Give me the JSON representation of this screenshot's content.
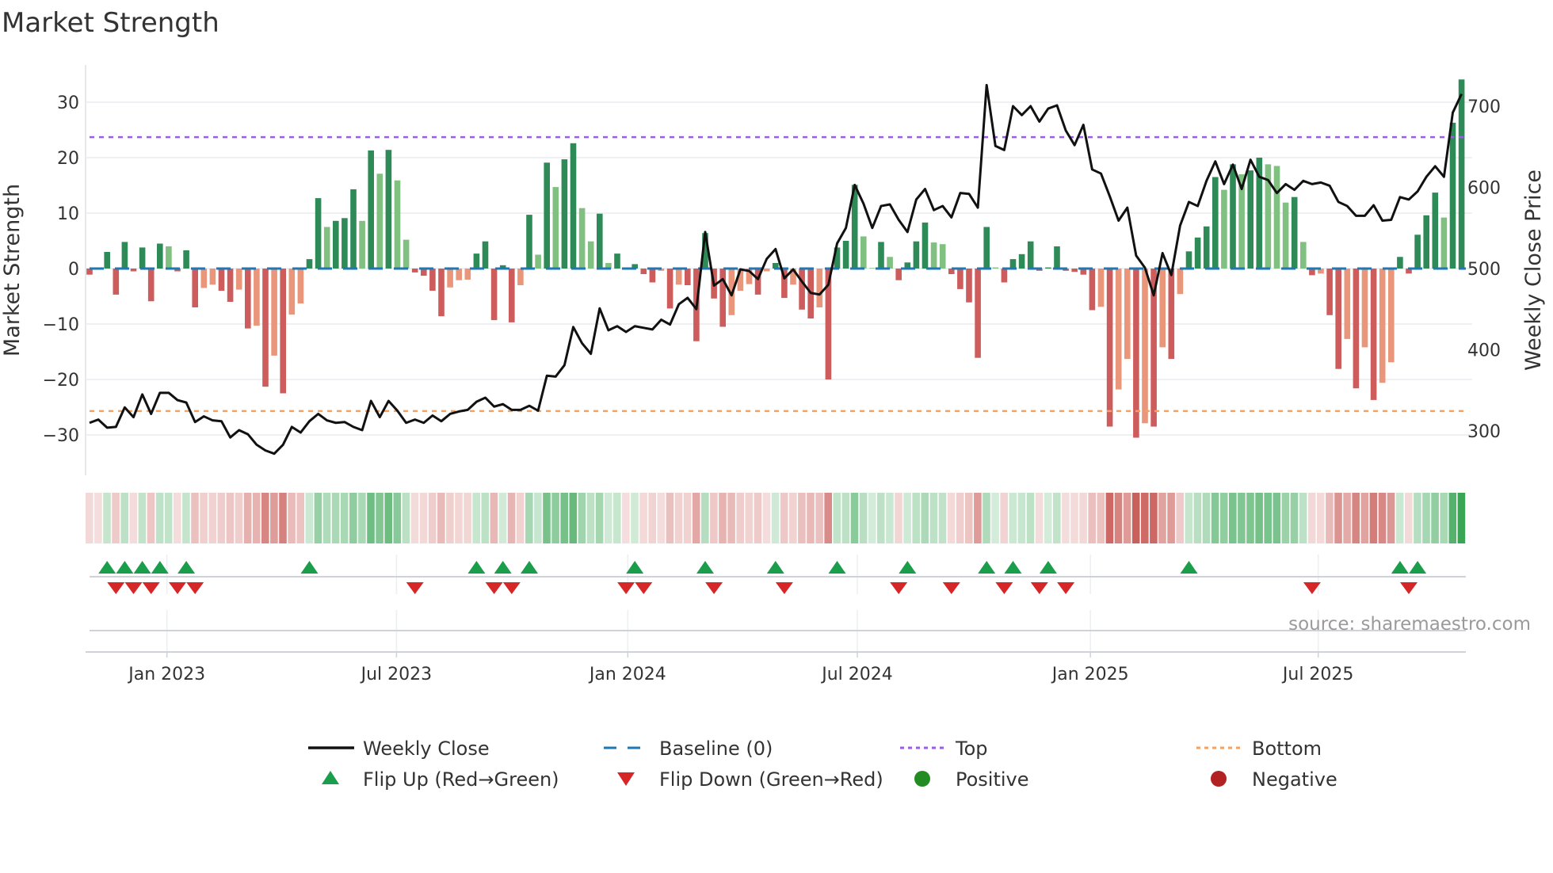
{
  "chart_data": {
    "type": "bar",
    "title": "Market Strength",
    "ylabel": "Market Strength",
    "y2label": "Weekly Close Price",
    "ylim": [
      -37.3,
      36.7
    ],
    "y2lim": [
      245,
      751
    ],
    "yticks": [
      -30,
      -20,
      -10,
      0,
      10,
      20,
      30
    ],
    "ytick_labels": [
      "−30",
      "−20",
      "−10",
      "0",
      "10",
      "20",
      "30"
    ],
    "y2ticks": [
      300,
      400,
      500,
      600,
      700
    ],
    "y2tick_labels": [
      "300",
      "400",
      "500",
      "600",
      "700"
    ],
    "x_ticks": [
      {
        "label": "Jan 2023",
        "week": 8.8
      },
      {
        "label": "Jul 2023",
        "week": 34.9
      },
      {
        "label": "Jan 2024",
        "week": 61.2
      },
      {
        "label": "Jul 2024",
        "week": 87.3
      },
      {
        "label": "Jan 2025",
        "week": 113.8
      },
      {
        "label": "Jul 2025",
        "week": 139.7
      }
    ],
    "top_level": 23.7,
    "bottom_level": -25.7,
    "baseline": 0,
    "grid": true,
    "legend_placement": "bottom-center",
    "series": [
      {
        "name": "Market Strength",
        "kind": "bar",
        "axis": "left",
        "values": [
          -1.1,
          -0.1,
          3,
          -4.7,
          4.8,
          -0.5,
          3.8,
          -5.9,
          4.5,
          4.0,
          -0.5,
          3.3,
          -7,
          -3.5,
          -2.9,
          -4,
          -6,
          -3.8,
          -10.8,
          -10.3,
          -21.3,
          -15.7,
          -22.5,
          -8.3,
          -6.3,
          1.7,
          12.7,
          7.5,
          8.6,
          9.1,
          14.3,
          8.6,
          21.3,
          17.1,
          21.4,
          15.9,
          5.2,
          -0.7,
          -1.3,
          -4.0,
          -8.6,
          -3.4,
          -2.1,
          -2.0,
          2.7,
          4.9,
          -9.3,
          0.6,
          -9.7,
          -3.0,
          9.7,
          2.5,
          19.1,
          14.7,
          19.7,
          22.6,
          10.9,
          4.9,
          9.9,
          1.0,
          2.7,
          -0.2,
          0.8,
          -1.0,
          -2.5,
          -0.4,
          -7.2,
          -2.9,
          -3.0,
          -13.1,
          6.4,
          -5.4,
          -10.5,
          -8.4,
          -4.0,
          -2.8,
          -4.7,
          -0.5,
          1.0,
          -5.3,
          -2.9,
          -7.4,
          -9.0,
          -7.0,
          -20.0,
          3.8,
          5.0,
          15.1,
          5.8,
          0.1,
          4.8,
          2.1,
          -2.1,
          1.1,
          4.9,
          8.3,
          4.7,
          4.4,
          -1.0,
          -3.7,
          -6.1,
          -16.1,
          7.5,
          0.2,
          -2.5,
          1.7,
          2.6,
          4.9,
          -0.4,
          0.2,
          4.0,
          -0.4,
          -0.6,
          -1.1,
          -7.5,
          -6.9,
          -28.5,
          -21.8,
          -16.3,
          -30.5,
          -27.9,
          -28.5,
          -14.2,
          -16.3,
          -4.6,
          3.1,
          5.6,
          7.6,
          16.5,
          14.2,
          18.8,
          17.0,
          17.7,
          20.0,
          18.8,
          18.5,
          11.9,
          12.9,
          4.8,
          -1.2,
          -0.9,
          -8.4,
          -18.1,
          -12.7,
          -21.6,
          -14.2,
          -23.7,
          -20.6,
          -16.9,
          2.1,
          -0.9,
          6.1,
          9.6,
          13.7,
          9.2,
          26.3,
          34.1
        ]
      },
      {
        "name": "Weekly Close",
        "kind": "line",
        "axis": "right",
        "values": [
          310,
          314,
          304,
          305,
          329,
          317,
          345,
          321,
          347,
          347,
          338,
          335,
          311,
          318,
          313,
          312,
          292,
          301,
          296,
          283,
          276,
          272,
          283,
          305,
          298,
          312,
          321,
          313,
          310,
          311,
          305,
          301,
          337,
          317,
          337,
          325,
          310,
          314,
          310,
          319,
          312,
          321,
          324,
          326,
          336,
          341,
          330,
          333,
          326,
          326,
          331,
          325,
          368,
          367,
          381,
          428,
          408,
          395,
          451,
          424,
          429,
          422,
          429,
          427,
          425,
          437,
          431,
          456,
          464,
          450,
          545,
          479,
          487,
          467,
          499,
          497,
          487,
          512,
          524,
          488,
          499,
          484,
          470,
          468,
          480,
          531,
          550,
          603,
          580,
          550,
          577,
          579,
          560,
          545,
          585,
          598,
          572,
          577,
          563,
          593,
          592,
          575,
          726,
          651,
          646,
          700,
          689,
          700,
          681,
          697,
          701,
          670,
          652,
          677,
          622,
          617,
          589,
          559,
          575,
          516,
          501,
          467,
          519,
          492,
          553,
          582,
          577,
          608,
          632,
          604,
          628,
          598,
          634,
          613,
          609,
          593,
          604,
          597,
          608,
          604,
          606,
          602,
          582,
          577,
          565,
          565,
          578,
          559,
          560,
          588,
          585,
          595,
          613,
          626,
          613,
          692,
          715
        ]
      }
    ],
    "legend": [
      {
        "label": "Weekly Close",
        "symbol": "solid-line",
        "color": "#111111"
      },
      {
        "label": "Baseline (0)",
        "symbol": "dashed-line",
        "color": "#1f77b4"
      },
      {
        "label": "Top",
        "symbol": "dotted-line",
        "color": "#9b5de5"
      },
      {
        "label": "Bottom",
        "symbol": "dotted-line",
        "color": "#f4a261"
      },
      {
        "label": "Flip Up (Red→Green)",
        "symbol": "triangle-up",
        "color": "#1a9e4b"
      },
      {
        "label": "Flip Down (Green→Red)",
        "symbol": "triangle-down",
        "color": "#d62728"
      },
      {
        "label": "Positive",
        "symbol": "circle",
        "color": "#228b22"
      },
      {
        "label": "Negative",
        "symbol": "circle",
        "color": "#b22222"
      }
    ],
    "source": "source: sharemaestro.com"
  },
  "colors": {
    "pos_strong": "#2e8b57",
    "pos_weak": "#80c080",
    "neg_strong": "#cd5c5c",
    "neg_weak": "#e9967a",
    "line": "#111111",
    "baseline": "#1f77b4",
    "top": "#9b5de5",
    "bottom": "#f4a261",
    "flip_up": "#1a9e4b",
    "flip_down": "#d62728",
    "grid": "#eef0f4"
  }
}
